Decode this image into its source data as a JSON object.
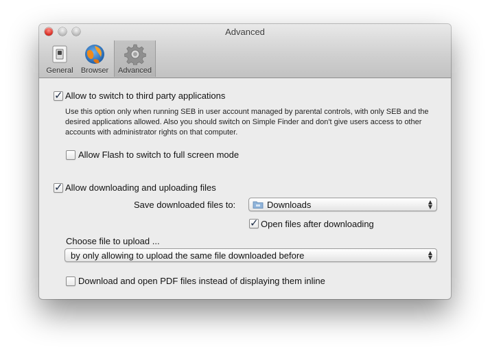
{
  "window": {
    "title": "Advanced"
  },
  "toolbar": {
    "items": [
      {
        "label": "General",
        "icon": "switch-icon"
      },
      {
        "label": "Browser",
        "icon": "browser-globe-icon"
      },
      {
        "label": "Advanced",
        "icon": "gear-icon",
        "selected": true
      }
    ]
  },
  "options": {
    "third_party": {
      "label": "Allow to switch to third party applications",
      "checked": true,
      "help": "Use this option only when running SEB in user account managed by parental controls, with only SEB and the desired applications allowed. Also you should switch on Simple Finder and don't give users access to other accounts with administrator rights on that computer."
    },
    "flash": {
      "label": "Allow Flash to switch to full screen mode",
      "checked": false
    },
    "downloads": {
      "label": "Allow downloading and uploading files",
      "checked": true
    },
    "save_to": {
      "label": "Save downloaded files to:",
      "value": "Downloads"
    },
    "open_after": {
      "label": "Open files after downloading",
      "checked": true
    },
    "choose_upload": {
      "label": "Choose file to upload ...",
      "value": "by only allowing to upload the same file downloaded before"
    },
    "pdf": {
      "label": "Download and open PDF files instead of displaying them inline",
      "checked": false
    }
  },
  "colors": {
    "close": "#d5281f",
    "window_bg": "#ececec",
    "toolbar_selected": "#b4b4b4"
  }
}
